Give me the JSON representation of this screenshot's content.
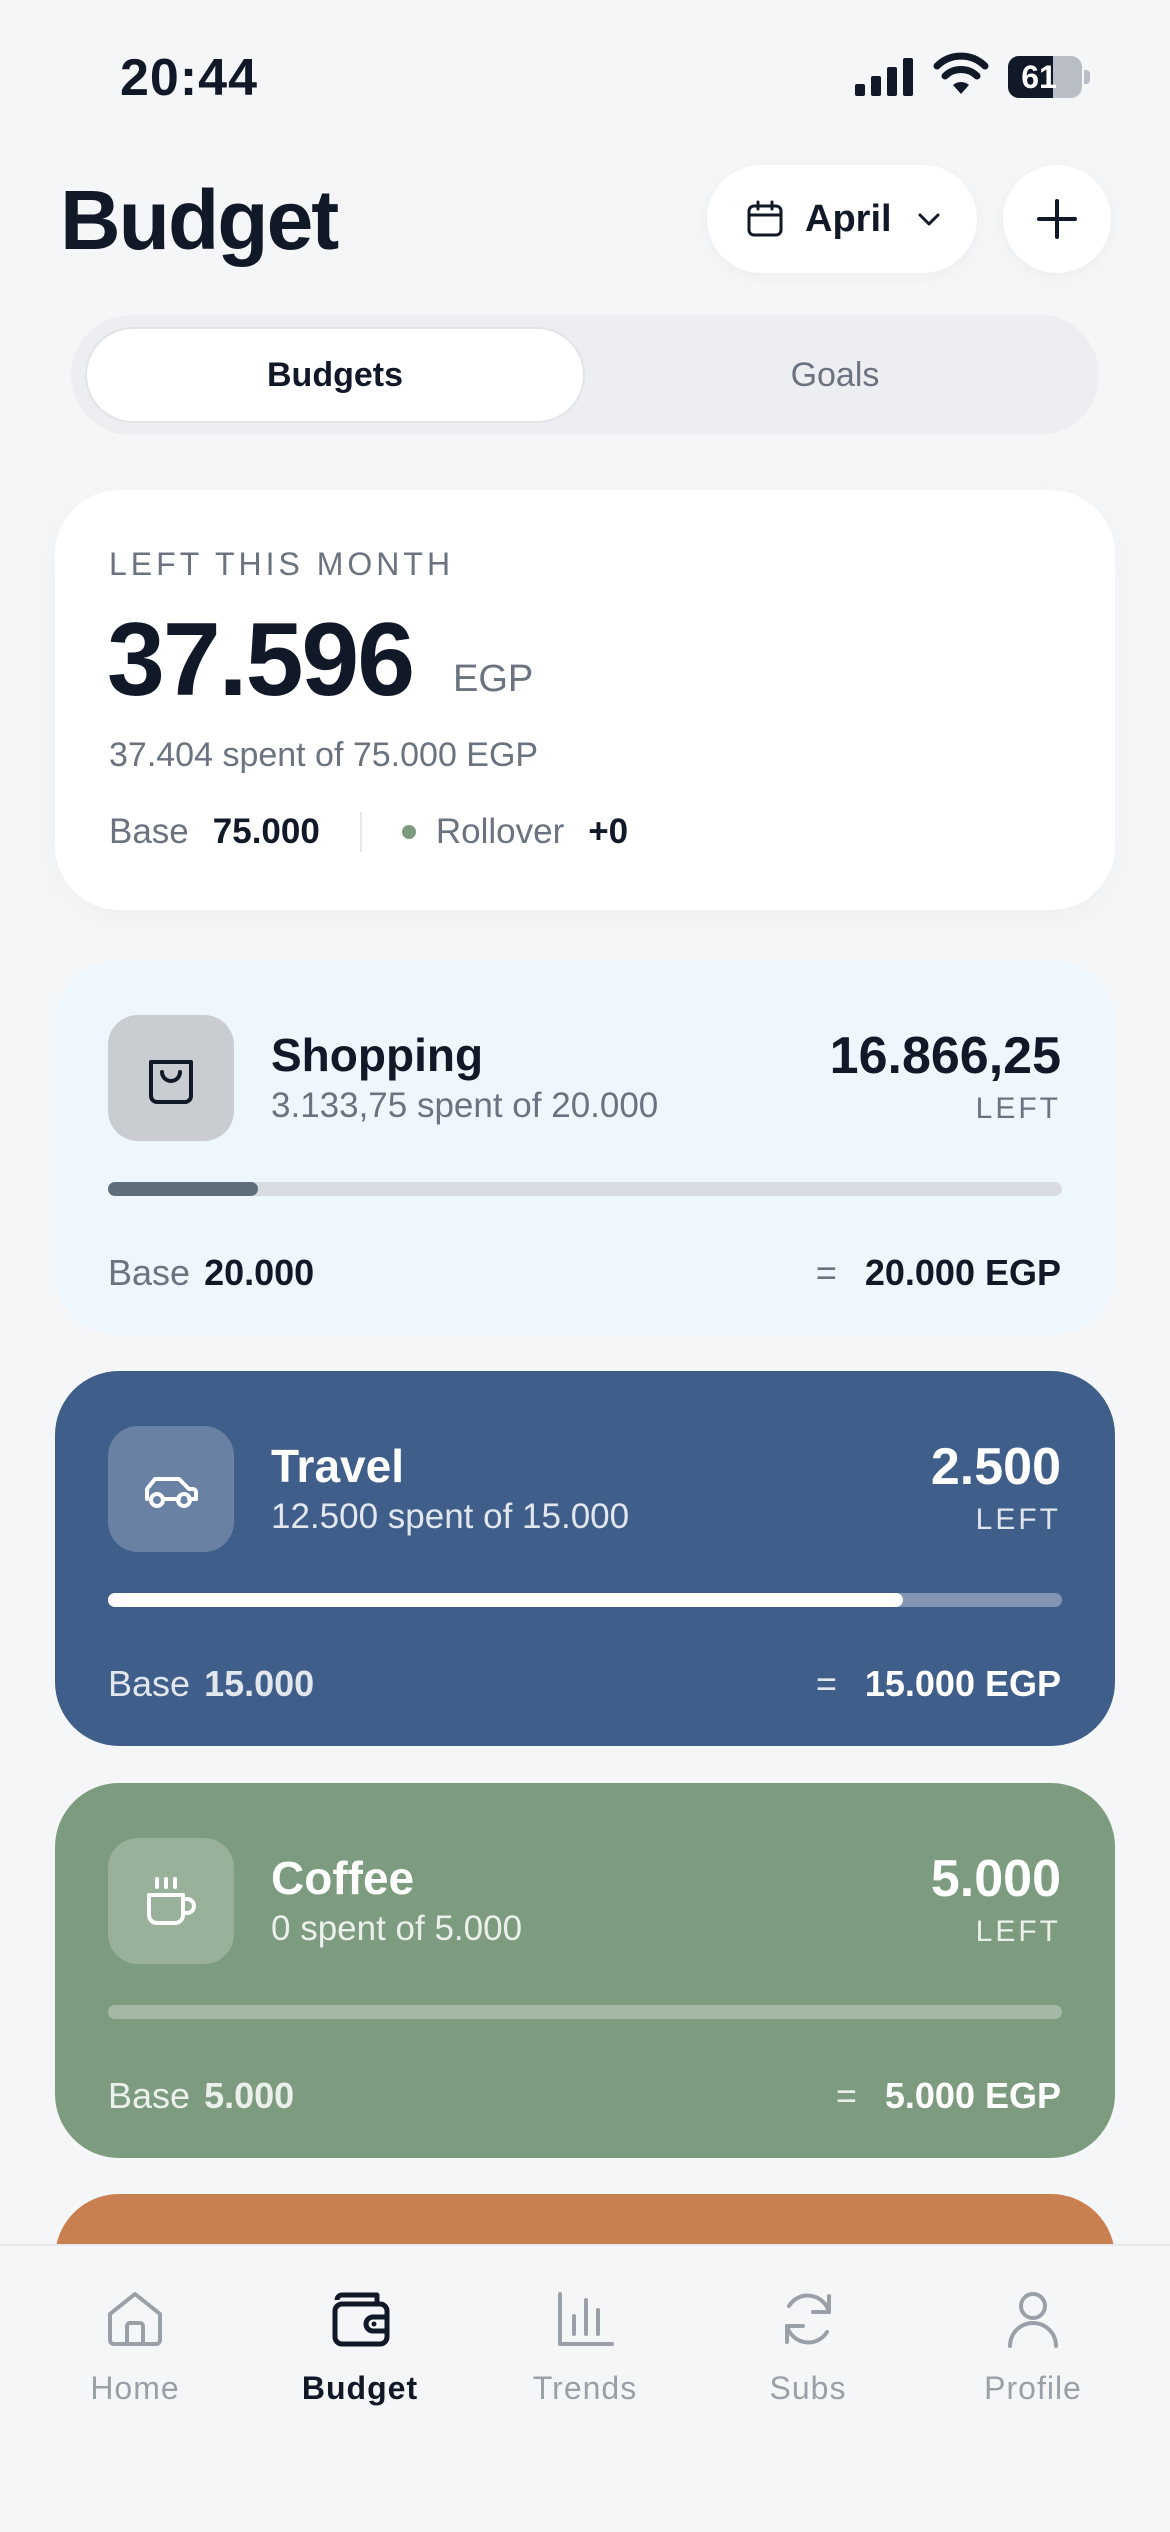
{
  "status_bar": {
    "time": "20:44",
    "battery": "61",
    "battery_level": 0.61
  },
  "header": {
    "title": "Budget",
    "month": "April"
  },
  "tabs": [
    {
      "label": "Budgets",
      "active": true
    },
    {
      "label": "Goals",
      "active": false
    }
  ],
  "summary": {
    "label": "LEFT THIS MONTH",
    "amount": "37.596",
    "currency": "EGP",
    "spent_text": "37.404 spent of 75.000 EGP",
    "base_label": "Base",
    "base_value": "75.000",
    "rollover_label": "Rollover",
    "rollover_value": "+0"
  },
  "categories": [
    {
      "name": "Shopping",
      "icon": "shopping-bag-icon",
      "spent_text": "3.133,75 spent of 20.000",
      "left_amount": "16.866,25",
      "left_label": "LEFT",
      "progress": 0.157,
      "base_label": "Base",
      "base_value": "20.000",
      "equals": "=",
      "total": "20.000 EGP",
      "color": "#eef6fe"
    },
    {
      "name": "Travel",
      "icon": "car-icon",
      "spent_text": "12.500 spent of 15.000",
      "left_amount": "2.500",
      "left_label": "LEFT",
      "progress": 0.833,
      "base_label": "Base",
      "base_value": "15.000",
      "equals": "=",
      "total": "15.000 EGP",
      "color": "#3f5e8a"
    },
    {
      "name": "Coffee",
      "icon": "coffee-cup-icon",
      "spent_text": "0 spent of 5.000",
      "left_amount": "5.000",
      "left_label": "LEFT",
      "progress": 0,
      "base_label": "Base",
      "base_value": "5.000",
      "equals": "=",
      "total": "5.000 EGP",
      "color": "#7d9b7e"
    }
  ],
  "nav": [
    {
      "label": "Home",
      "icon": "home-icon",
      "active": false
    },
    {
      "label": "Budget",
      "icon": "wallet-icon",
      "active": true
    },
    {
      "label": "Trends",
      "icon": "bar-chart-icon",
      "active": false
    },
    {
      "label": "Subs",
      "icon": "refresh-icon",
      "active": false
    },
    {
      "label": "Profile",
      "icon": "user-icon",
      "active": false
    }
  ]
}
